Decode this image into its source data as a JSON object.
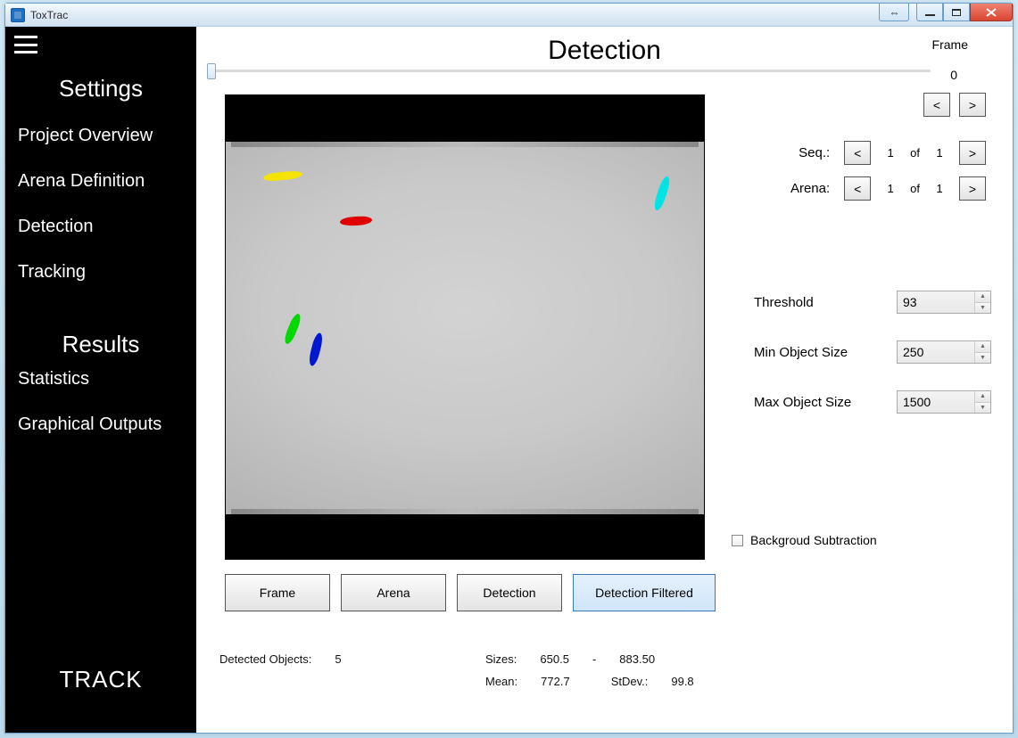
{
  "app": {
    "title": "ToxTrac"
  },
  "sidebar": {
    "section_settings": "Settings",
    "section_results": "Results",
    "items": {
      "project_overview": "Project Overview",
      "arena_definition": "Arena Definition",
      "detection": "Detection",
      "tracking": "Tracking",
      "statistics": "Statistics",
      "graphical_outputs": "Graphical Outputs"
    },
    "track_label": "TRACK"
  },
  "main": {
    "title": "Detection",
    "frame_label": "Frame",
    "frame_value": "0",
    "prev": "<",
    "next": ">",
    "seq": {
      "label": "Seq.:",
      "cur": "1",
      "of": "of",
      "total": "1"
    },
    "arena": {
      "label": "Arena:",
      "cur": "1",
      "of": "of",
      "total": "1"
    },
    "params": {
      "threshold": {
        "label": "Threshold",
        "value": "93"
      },
      "min_obj": {
        "label": "Min Object Size",
        "value": "250"
      },
      "max_obj": {
        "label": "Max Object Size",
        "value": "1500"
      },
      "bg_sub": {
        "label": "Backgroud Subtraction",
        "checked": false
      }
    },
    "tabs": {
      "frame": "Frame",
      "arena": "Arena",
      "detection": "Detection",
      "detection_filtered": "Detection Filtered"
    },
    "stats": {
      "detected_label": "Detected Objects:",
      "detected_val": "5",
      "sizes_label": "Sizes:",
      "size_min": "650.5",
      "size_dash": "-",
      "size_max": "883.50",
      "mean_label": "Mean:",
      "mean_val": "772.7",
      "stdev_label": "StDev.:",
      "stdev_val": "99.8"
    }
  },
  "blobs": {
    "colors": {
      "yellow": "#f5e400",
      "red": "#e00000",
      "cyan": "#00e4e4",
      "green": "#00d800",
      "blue": "#0018d0"
    }
  }
}
